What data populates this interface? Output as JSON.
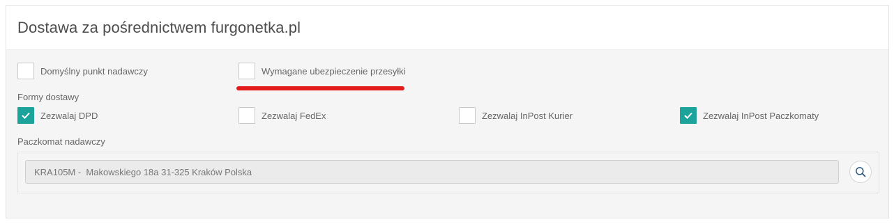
{
  "panel": {
    "title": "Dostawa za pośrednictwem furgonetka.pl"
  },
  "options": {
    "default_point": {
      "label": "Domyślny punkt nadawczy",
      "checked": false
    },
    "insurance": {
      "label": "Wymagane ubezpieczenie przesyłki",
      "checked": false
    }
  },
  "delivery": {
    "section_label": "Formy dostawy",
    "items": [
      {
        "label": "Zezwalaj DPD",
        "checked": true
      },
      {
        "label": "Zezwalaj FedEx",
        "checked": false
      },
      {
        "label": "Zezwalaj InPost Kurier",
        "checked": false
      },
      {
        "label": "Zezwalaj InPost Paczkomaty",
        "checked": true
      }
    ]
  },
  "locker": {
    "section_label": "Paczkomat nadawczy",
    "value": "KRA105M -  Makowskiego 18a 31-325 Kraków Polska"
  },
  "icons": {
    "check": "check-icon",
    "search": "search-icon"
  },
  "colors": {
    "checked": "#1ba39c",
    "annotation": "#e41b1b"
  }
}
